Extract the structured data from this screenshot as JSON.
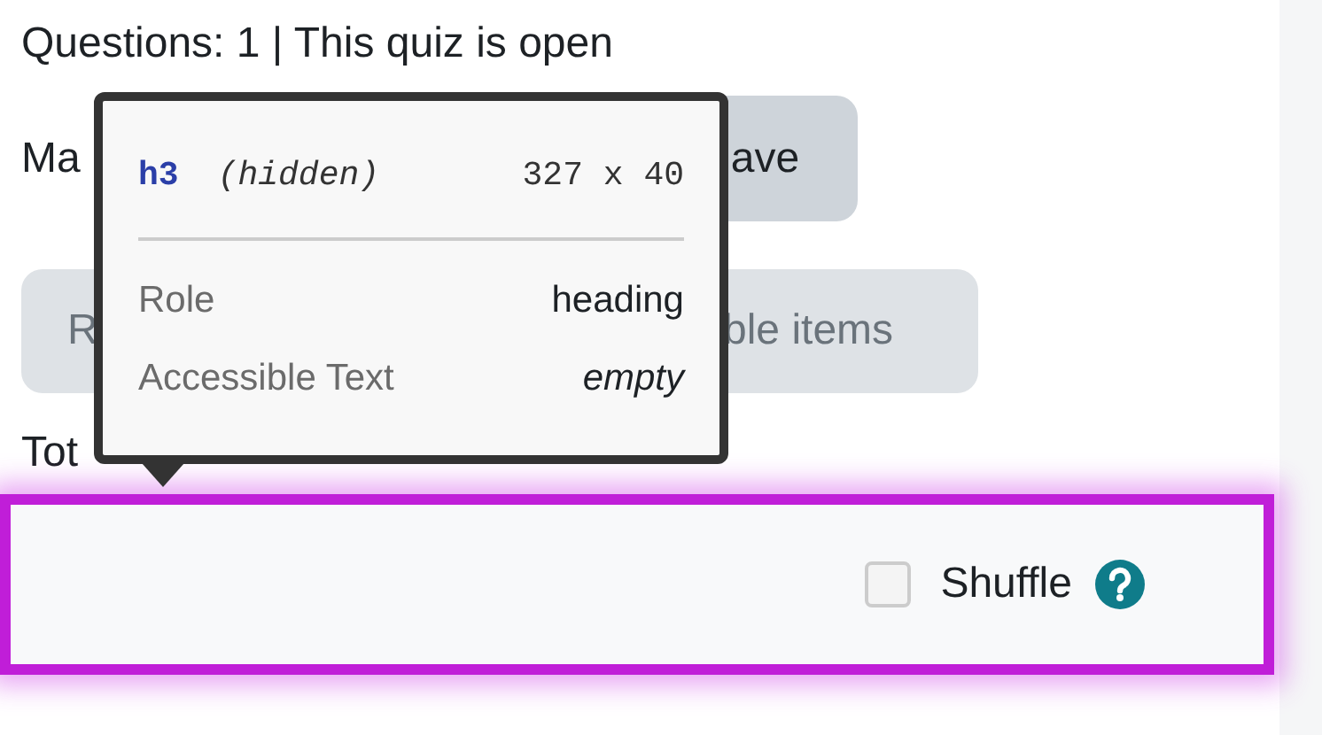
{
  "summary": "Questions: 1 | This quiz is open",
  "max_grade_label": "Ma",
  "save_button": "ave",
  "row_buttons": [
    "R",
    "ble items"
  ],
  "total_label": "Tot",
  "section": {
    "shuffle": {
      "label": "Shuffle",
      "checked": false
    }
  },
  "tooltip": {
    "tag": "h3",
    "note": "(hidden)",
    "size": "327 x 40",
    "rows": [
      {
        "label": "Role",
        "value": "heading",
        "italic": false
      },
      {
        "label": "Accessible Text",
        "value": "empty",
        "italic": true
      }
    ]
  }
}
